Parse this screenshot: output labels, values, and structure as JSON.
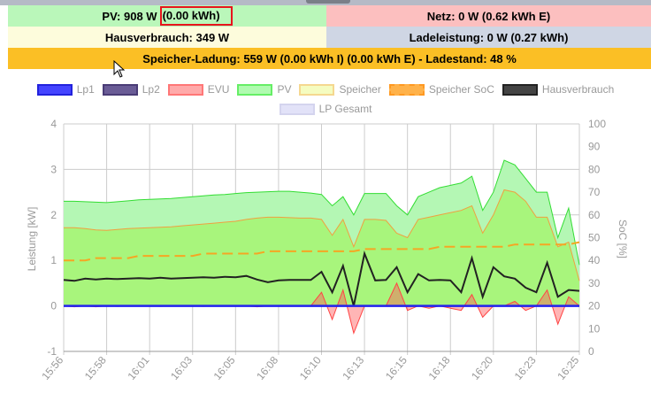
{
  "status": {
    "pv_label": "PV: 908 W",
    "pv_energy": "(0.00 kWh)",
    "netz": "Netz: 0 W (0.62 kWh E)",
    "hausverbrauch": "Hausverbrauch: 349 W",
    "ladeleistung": "Ladeleistung: 0 W (0.27 kWh)",
    "speicher": "Speicher-Ladung: 559 W (0.00 kWh I) (0.00 kWh E) - Ladestand: 48 %"
  },
  "colors": {
    "pv_fill": "#b4f7b4",
    "pv_line": "#33dd33",
    "speicher_fill": "#a8f57c",
    "speicher_line": "#f0a040",
    "evu": "#ff4444",
    "haus": "#222222",
    "lp1": "#2222ee",
    "soc": "#f5a623"
  },
  "chart_data": {
    "type": "area",
    "ylabel": "Leistung [kW]",
    "y2label": "SoC [%]",
    "ylim": [
      -1,
      4
    ],
    "y2lim": [
      0,
      100
    ],
    "yticks": [
      "4",
      "3",
      "2",
      "1",
      "0",
      "-1"
    ],
    "y2ticks": [
      "100",
      "90",
      "80",
      "70",
      "60",
      "50",
      "40",
      "30",
      "20",
      "10",
      "0"
    ],
    "xticks": [
      "15:56",
      "15:58",
      "16:01",
      "16:03",
      "16:05",
      "16:08",
      "16:10",
      "16:13",
      "16:15",
      "16:18",
      "16:20",
      "16:23",
      "16:25"
    ],
    "legend": [
      {
        "name": "Lp1",
        "fill": "#4444ff",
        "border": "#2222dd"
      },
      {
        "name": "Lp2",
        "fill": "#6a5c96",
        "border": "#4a3c76"
      },
      {
        "name": "EVU",
        "fill": "#ffaaaa",
        "border": "#ff7777"
      },
      {
        "name": "PV",
        "fill": "#b0fbb0",
        "border": "#66ee66"
      },
      {
        "name": "Speicher",
        "fill": "#f5fcc0",
        "border": "#f5d890"
      },
      {
        "name": "Speicher SoC",
        "fill": "#ffb24a",
        "border": "#ff9922"
      },
      {
        "name": "Hausverbrauch",
        "fill": "#444444",
        "border": "#222222"
      },
      {
        "name": "LP Gesamt",
        "fill": "#e2e2f8",
        "border": "#d4d4ee"
      }
    ],
    "series": {
      "PV": [
        2.3,
        2.3,
        2.29,
        2.28,
        2.27,
        2.29,
        2.31,
        2.33,
        2.34,
        2.35,
        2.36,
        2.38,
        2.4,
        2.42,
        2.44,
        2.45,
        2.47,
        2.49,
        2.5,
        2.51,
        2.52,
        2.52,
        2.5,
        2.48,
        2.45,
        2.2,
        2.4,
        2.0,
        2.47,
        2.47,
        2.47,
        2.2,
        2.0,
        2.4,
        2.5,
        2.6,
        2.65,
        2.7,
        2.85,
        2.1,
        2.5,
        3.2,
        3.1,
        2.8,
        2.5,
        2.5,
        1.5,
        2.15,
        0.9
      ],
      "Speicher": [
        1.72,
        1.72,
        1.7,
        1.67,
        1.66,
        1.68,
        1.7,
        1.71,
        1.72,
        1.73,
        1.74,
        1.76,
        1.78,
        1.8,
        1.82,
        1.84,
        1.86,
        1.9,
        1.93,
        1.95,
        1.95,
        1.94,
        1.93,
        1.93,
        1.9,
        1.55,
        1.9,
        1.3,
        1.9,
        1.9,
        1.88,
        1.6,
        1.5,
        1.9,
        1.95,
        2.0,
        2.05,
        2.1,
        2.2,
        1.6,
        2.0,
        2.55,
        2.5,
        2.3,
        1.95,
        1.95,
        1.3,
        1.4,
        0.55
      ],
      "Hausverbrauch": [
        0.57,
        0.55,
        0.6,
        0.58,
        0.6,
        0.59,
        0.6,
        0.61,
        0.6,
        0.62,
        0.6,
        0.61,
        0.62,
        0.63,
        0.62,
        0.64,
        0.63,
        0.66,
        0.58,
        0.52,
        0.56,
        0.57,
        0.57,
        0.57,
        0.75,
        0.3,
        0.88,
        0.0,
        1.15,
        0.56,
        0.57,
        0.85,
        0.3,
        0.7,
        0.56,
        0.57,
        0.56,
        0.3,
        1.05,
        0.2,
        0.85,
        0.65,
        0.6,
        0.4,
        0.3,
        0.95,
        0.2,
        0.35,
        0.33
      ],
      "EVU": [
        0,
        -0.02,
        0,
        -0.02,
        0,
        -0.01,
        0,
        0,
        0,
        -0.01,
        0,
        0,
        0,
        -0.01,
        0,
        0,
        0,
        0,
        -0.02,
        0,
        0,
        0,
        0,
        0,
        0.3,
        -0.3,
        0.35,
        -0.6,
        0,
        0,
        0,
        0.5,
        -0.1,
        0,
        -0.05,
        0,
        -0.05,
        -0.1,
        0.25,
        -0.25,
        0,
        0,
        0.1,
        -0.1,
        0,
        0.35,
        -0.4,
        0.2,
        0
      ],
      "SoC": [
        40,
        40,
        40,
        41,
        41,
        41,
        41,
        42,
        42,
        42,
        42,
        42,
        42,
        43,
        43,
        43,
        43,
        43,
        43,
        44,
        44,
        44,
        44,
        44,
        44,
        44,
        44,
        44,
        45,
        45,
        45,
        45,
        45,
        45,
        45,
        46,
        46,
        46,
        46,
        46,
        46,
        46,
        47,
        47,
        47,
        47,
        47,
        47,
        48
      ],
      "Lp1": [
        0,
        0
      ]
    }
  }
}
